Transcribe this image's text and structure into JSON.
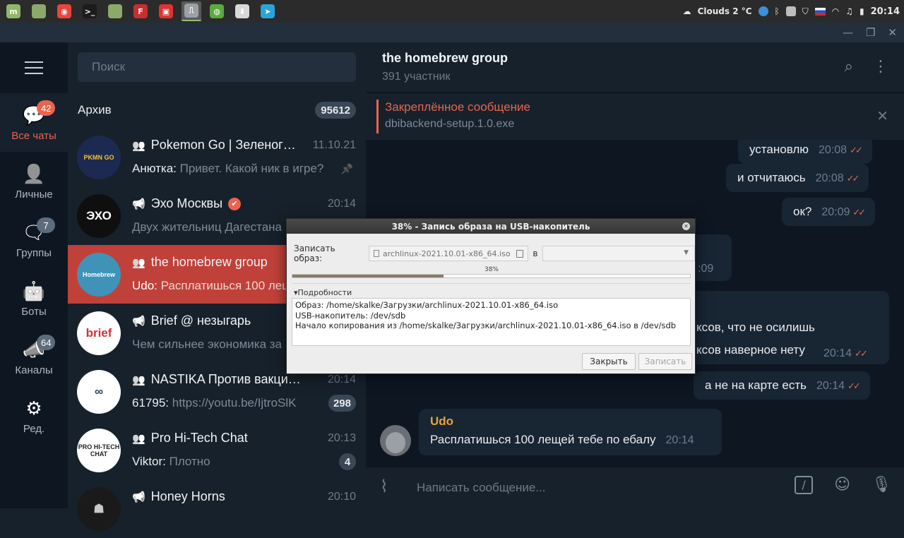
{
  "taskbar": {
    "apps": [
      {
        "name": "mint-menu-icon",
        "color": "#8fb769",
        "glyph": "m"
      },
      {
        "name": "files-icon",
        "color": "#8aa96a",
        "glyph": ""
      },
      {
        "name": "chrome-icon",
        "color": "#e8453c",
        "glyph": "◉"
      },
      {
        "name": "terminal-icon",
        "color": "#1c1c1c",
        "glyph": ">_"
      },
      {
        "name": "folder-icon",
        "color": "#8aa96a",
        "glyph": ""
      },
      {
        "name": "app-red-icon",
        "color": "#c62f2f",
        "glyph": "F"
      },
      {
        "name": "app-box-icon",
        "color": "#d33",
        "glyph": "▣"
      },
      {
        "name": "usb-writer-icon",
        "color": "#9aa0a6",
        "glyph": "⎍"
      },
      {
        "name": "network-icon",
        "color": "#5aaa3f",
        "glyph": "◍"
      },
      {
        "name": "installer-icon",
        "color": "#d8d8d8",
        "glyph": "⬇"
      },
      {
        "name": "telegram-icon",
        "color": "#2aa3d8",
        "glyph": "➤"
      }
    ],
    "weather": "Clouds 2 °C",
    "clock": "20:14"
  },
  "nav": {
    "items": [
      {
        "label": "Все чаты",
        "badge": "42",
        "icon": "chats-icon"
      },
      {
        "label": "Личные",
        "badge": "",
        "icon": "person-icon"
      },
      {
        "label": "Группы",
        "badge": "7",
        "icon": "groups-icon"
      },
      {
        "label": "Боты",
        "badge": "",
        "icon": "bot-icon"
      },
      {
        "label": "Каналы",
        "badge": "64",
        "icon": "channels-icon"
      },
      {
        "label": "Ред.",
        "badge": "",
        "icon": "edit-filters-icon"
      }
    ]
  },
  "chatlist": {
    "search_placeholder": "Поиск",
    "archive_label": "Архив",
    "archive_count": "95612",
    "rows": [
      {
        "name": "Pokemon Go | Зеленоград",
        "time": "11.10.21",
        "who": "Анютка: ",
        "text": "Привет. Какой ник в игре?",
        "group": true,
        "pinned": true,
        "pill": "",
        "avatar_bg": "#1c2a52",
        "avatar_text": "PKMN GO",
        "avatar_fg": "#f7c12a"
      },
      {
        "name": "Эхо Москвы",
        "time": "20:14",
        "who": "",
        "text": "Двух жительниц Дагестана",
        "channel": true,
        "verified": true,
        "pill": "",
        "avatar_bg": "#0f0f0f",
        "avatar_text": "ЭХО",
        "avatar_fg": "#ffffff"
      },
      {
        "name": "the homebrew group",
        "time": "",
        "who": "Udo: ",
        "text": "Расплатишься 100 лещей",
        "group": true,
        "selected": true,
        "pill": "",
        "avatar_bg": "#3f93b8",
        "avatar_text": "Homebrew",
        "avatar_fg": "#ffffff"
      },
      {
        "name": "Brief @ незыгарь",
        "time": "",
        "who": "",
        "text": "Чем сильнее экономика за",
        "channel": true,
        "pill": "",
        "avatar_bg": "#ffffff",
        "avatar_text": "brief",
        "avatar_fg": "#d03232"
      },
      {
        "name": "NASTIKA Против вакцина",
        "time": "20:14",
        "who": "61795: ",
        "text": "https://youtu.be/IjtroSlK",
        "group": true,
        "pill": "298",
        "avatar_bg": "#ffffff",
        "avatar_text": "∞",
        "avatar_fg": "#2c3e50"
      },
      {
        "name": "Pro Hi-Tech Chat",
        "time": "20:13",
        "who": "Viktor: ",
        "text": "Плотно",
        "group": true,
        "pill": "4",
        "avatar_bg": "#ffffff",
        "avatar_text": "PRO HI-TECH CHAT",
        "avatar_fg": "#222222"
      },
      {
        "name": "Honey Horns",
        "time": "20:10",
        "who": "",
        "text": "",
        "channel": true,
        "pill": "",
        "avatar_bg": "#1a1a1a",
        "avatar_text": "☗",
        "avatar_fg": "#c9c9c9"
      }
    ]
  },
  "chat": {
    "title": "the homebrew group",
    "subtitle": "391 участник",
    "pinned_label": "Закреплённое сообщение",
    "pinned_text": "dbibackend-setup.1.0.exe",
    "messages": [
      {
        "text": "установлю",
        "time": "20:08"
      },
      {
        "text": "и отчитаюсь",
        "time": "20:08"
      },
      {
        "text": "ок?",
        "time": "20:09"
      },
      {
        "text": "",
        "time": ":09"
      },
      {
        "text": "ксов, что не осилишь",
        "time": ""
      },
      {
        "text": "ксов наверное нету",
        "time": "20:14"
      },
      {
        "text": "а не на карте есть",
        "time": "20:14"
      }
    ],
    "incoming": {
      "author": "Udo",
      "text": "Расплатишься 100 лещей тебе по ебалу",
      "time": "20:14"
    },
    "composer_placeholder": "Написать сообщение..."
  },
  "dialog": {
    "title": "38% - Запись образа на USB-накопитель",
    "image_label": "Записать образ:",
    "image_file": "archlinux-2021.10.01-x86_64.iso",
    "to_label": "в",
    "progress_percent": 38,
    "progress_label": "38%",
    "details_label": "Подробности",
    "details_lines": [
      "Образ: /home/skalke/Загрузки/archlinux-2021.10.01-x86_64.iso",
      "USB-накопитель: /dev/sdb",
      "Начало копирования  из /home/skalke/Загрузки/archlinux-2021.10.01-x86_64.iso в /dev/sdb"
    ],
    "close_button": "Закрыть",
    "write_button": "Записать"
  },
  "colors": {
    "accent": "#e9644e",
    "selected_row": "#c0413a",
    "chat_bg": "#0e1621",
    "panel_bg": "#17212b"
  }
}
